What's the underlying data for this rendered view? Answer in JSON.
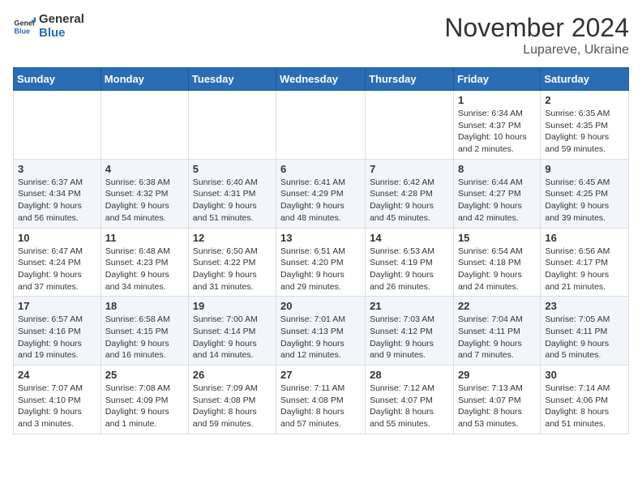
{
  "logo": {
    "line1": "General",
    "line2": "Blue"
  },
  "title": "November 2024",
  "location": "Lupareve, Ukraine",
  "days_of_week": [
    "Sunday",
    "Monday",
    "Tuesday",
    "Wednesday",
    "Thursday",
    "Friday",
    "Saturday"
  ],
  "weeks": [
    [
      {
        "day": "",
        "info": ""
      },
      {
        "day": "",
        "info": ""
      },
      {
        "day": "",
        "info": ""
      },
      {
        "day": "",
        "info": ""
      },
      {
        "day": "",
        "info": ""
      },
      {
        "day": "1",
        "info": "Sunrise: 6:34 AM\nSunset: 4:37 PM\nDaylight: 10 hours and 2 minutes."
      },
      {
        "day": "2",
        "info": "Sunrise: 6:35 AM\nSunset: 4:35 PM\nDaylight: 9 hours and 59 minutes."
      }
    ],
    [
      {
        "day": "3",
        "info": "Sunrise: 6:37 AM\nSunset: 4:34 PM\nDaylight: 9 hours and 56 minutes."
      },
      {
        "day": "4",
        "info": "Sunrise: 6:38 AM\nSunset: 4:32 PM\nDaylight: 9 hours and 54 minutes."
      },
      {
        "day": "5",
        "info": "Sunrise: 6:40 AM\nSunset: 4:31 PM\nDaylight: 9 hours and 51 minutes."
      },
      {
        "day": "6",
        "info": "Sunrise: 6:41 AM\nSunset: 4:29 PM\nDaylight: 9 hours and 48 minutes."
      },
      {
        "day": "7",
        "info": "Sunrise: 6:42 AM\nSunset: 4:28 PM\nDaylight: 9 hours and 45 minutes."
      },
      {
        "day": "8",
        "info": "Sunrise: 6:44 AM\nSunset: 4:27 PM\nDaylight: 9 hours and 42 minutes."
      },
      {
        "day": "9",
        "info": "Sunrise: 6:45 AM\nSunset: 4:25 PM\nDaylight: 9 hours and 39 minutes."
      }
    ],
    [
      {
        "day": "10",
        "info": "Sunrise: 6:47 AM\nSunset: 4:24 PM\nDaylight: 9 hours and 37 minutes."
      },
      {
        "day": "11",
        "info": "Sunrise: 6:48 AM\nSunset: 4:23 PM\nDaylight: 9 hours and 34 minutes."
      },
      {
        "day": "12",
        "info": "Sunrise: 6:50 AM\nSunset: 4:22 PM\nDaylight: 9 hours and 31 minutes."
      },
      {
        "day": "13",
        "info": "Sunrise: 6:51 AM\nSunset: 4:20 PM\nDaylight: 9 hours and 29 minutes."
      },
      {
        "day": "14",
        "info": "Sunrise: 6:53 AM\nSunset: 4:19 PM\nDaylight: 9 hours and 26 minutes."
      },
      {
        "day": "15",
        "info": "Sunrise: 6:54 AM\nSunset: 4:18 PM\nDaylight: 9 hours and 24 minutes."
      },
      {
        "day": "16",
        "info": "Sunrise: 6:56 AM\nSunset: 4:17 PM\nDaylight: 9 hours and 21 minutes."
      }
    ],
    [
      {
        "day": "17",
        "info": "Sunrise: 6:57 AM\nSunset: 4:16 PM\nDaylight: 9 hours and 19 minutes."
      },
      {
        "day": "18",
        "info": "Sunrise: 6:58 AM\nSunset: 4:15 PM\nDaylight: 9 hours and 16 minutes."
      },
      {
        "day": "19",
        "info": "Sunrise: 7:00 AM\nSunset: 4:14 PM\nDaylight: 9 hours and 14 minutes."
      },
      {
        "day": "20",
        "info": "Sunrise: 7:01 AM\nSunset: 4:13 PM\nDaylight: 9 hours and 12 minutes."
      },
      {
        "day": "21",
        "info": "Sunrise: 7:03 AM\nSunset: 4:12 PM\nDaylight: 9 hours and 9 minutes."
      },
      {
        "day": "22",
        "info": "Sunrise: 7:04 AM\nSunset: 4:11 PM\nDaylight: 9 hours and 7 minutes."
      },
      {
        "day": "23",
        "info": "Sunrise: 7:05 AM\nSunset: 4:11 PM\nDaylight: 9 hours and 5 minutes."
      }
    ],
    [
      {
        "day": "24",
        "info": "Sunrise: 7:07 AM\nSunset: 4:10 PM\nDaylight: 9 hours and 3 minutes."
      },
      {
        "day": "25",
        "info": "Sunrise: 7:08 AM\nSunset: 4:09 PM\nDaylight: 9 hours and 1 minute."
      },
      {
        "day": "26",
        "info": "Sunrise: 7:09 AM\nSunset: 4:08 PM\nDaylight: 8 hours and 59 minutes."
      },
      {
        "day": "27",
        "info": "Sunrise: 7:11 AM\nSunset: 4:08 PM\nDaylight: 8 hours and 57 minutes."
      },
      {
        "day": "28",
        "info": "Sunrise: 7:12 AM\nSunset: 4:07 PM\nDaylight: 8 hours and 55 minutes."
      },
      {
        "day": "29",
        "info": "Sunrise: 7:13 AM\nSunset: 4:07 PM\nDaylight: 8 hours and 53 minutes."
      },
      {
        "day": "30",
        "info": "Sunrise: 7:14 AM\nSunset: 4:06 PM\nDaylight: 8 hours and 51 minutes."
      }
    ]
  ]
}
